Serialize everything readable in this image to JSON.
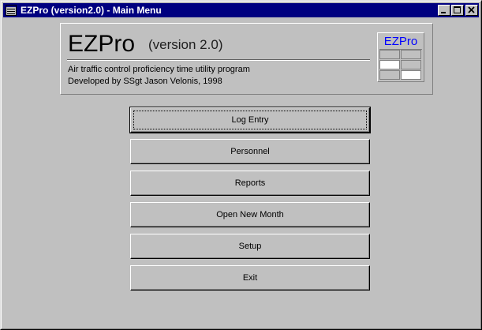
{
  "window": {
    "title": "EZPro (version2.0) - Main Menu",
    "controls": {
      "minimize": "_",
      "maximize": "□",
      "close": "✕"
    }
  },
  "header": {
    "app_name": "EZPro",
    "version": "(version 2.0)",
    "description": "Air traffic control proficiency time utility program",
    "credit": "Developed by SSgt Jason Velonis, 1998",
    "logo_text": "EZPro"
  },
  "menu": {
    "buttons": [
      {
        "label": "Log Entry"
      },
      {
        "label": "Personnel"
      },
      {
        "label": "Reports"
      },
      {
        "label": "Open New Month"
      },
      {
        "label": "Setup"
      },
      {
        "label": "Exit"
      }
    ]
  },
  "colors": {
    "titlebar": "#000080",
    "face": "#c0c0c0",
    "logo_text": "#0000ff"
  }
}
